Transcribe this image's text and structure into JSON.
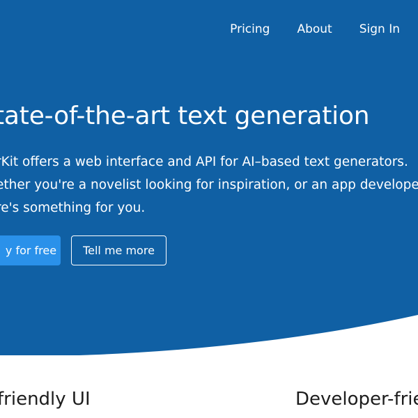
{
  "nav": {
    "items": [
      {
        "label": "Pricing"
      },
      {
        "label": "About"
      },
      {
        "label": "Sign In"
      }
    ]
  },
  "hero": {
    "headline": "tate-of-the-art text generation",
    "intro_lines": [
      "rKit offers a web interface and API for AI–based text generators.",
      "ether you're a novelist looking for inspiration, or an app developer,",
      "re's something for you."
    ],
    "primary_button": "y for free",
    "secondary_button": "Tell me more"
  },
  "features": {
    "left_title": "friendly UI",
    "right_title": "Developer-frie"
  },
  "colors": {
    "hero_bg": "#1060a4",
    "primary_button": "#2a91ea",
    "text_light": "#ffffff",
    "text_dark": "#1d1d1d"
  }
}
